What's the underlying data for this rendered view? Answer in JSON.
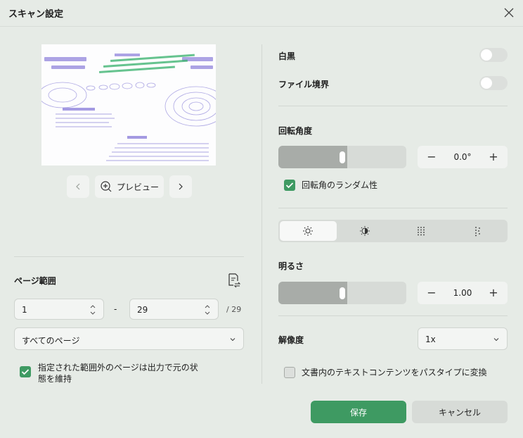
{
  "dialog": {
    "title": "スキャン設定"
  },
  "preview": {
    "prev_icon": "chevron-left-icon",
    "next_icon": "chevron-right-icon",
    "zoom_icon": "zoom-in-icon",
    "label": "プレビュー"
  },
  "page_range": {
    "label": "ページ範囲",
    "icon": "page-swap-icon",
    "from": "1",
    "separator": "-",
    "to": "29",
    "total": "/ 29",
    "scope_selected": "すべてのページ",
    "keep_outside_label": "指定された範囲外のページは出力で元の状態を維持",
    "keep_outside_checked": true
  },
  "options": {
    "bw_label": "白黒",
    "bw_on": false,
    "file_border_label": "ファイル境界",
    "file_border_on": false
  },
  "rotation": {
    "label": "回転角度",
    "slider_level": 0.5,
    "value": "0.0°",
    "random_label": "回転角のランダム性",
    "random_checked": true
  },
  "filters": {
    "modes": [
      "sun-icon",
      "contrast-icon",
      "dot-grid-icon",
      "scatter-dots-icon"
    ],
    "active_mode": "sun-icon"
  },
  "brightness": {
    "label": "明るさ",
    "slider_level": 0.5,
    "value": "1.00"
  },
  "resolution": {
    "label": "解像度",
    "selected": "1x"
  },
  "path_type": {
    "label": "文書内のテキストコンテンツをパスタイプに変換",
    "checked": false
  },
  "footer": {
    "save_label": "保存",
    "cancel_label": "キャンセル"
  },
  "colors": {
    "accent": "#3e9a62",
    "background": "#e6ebe6"
  }
}
